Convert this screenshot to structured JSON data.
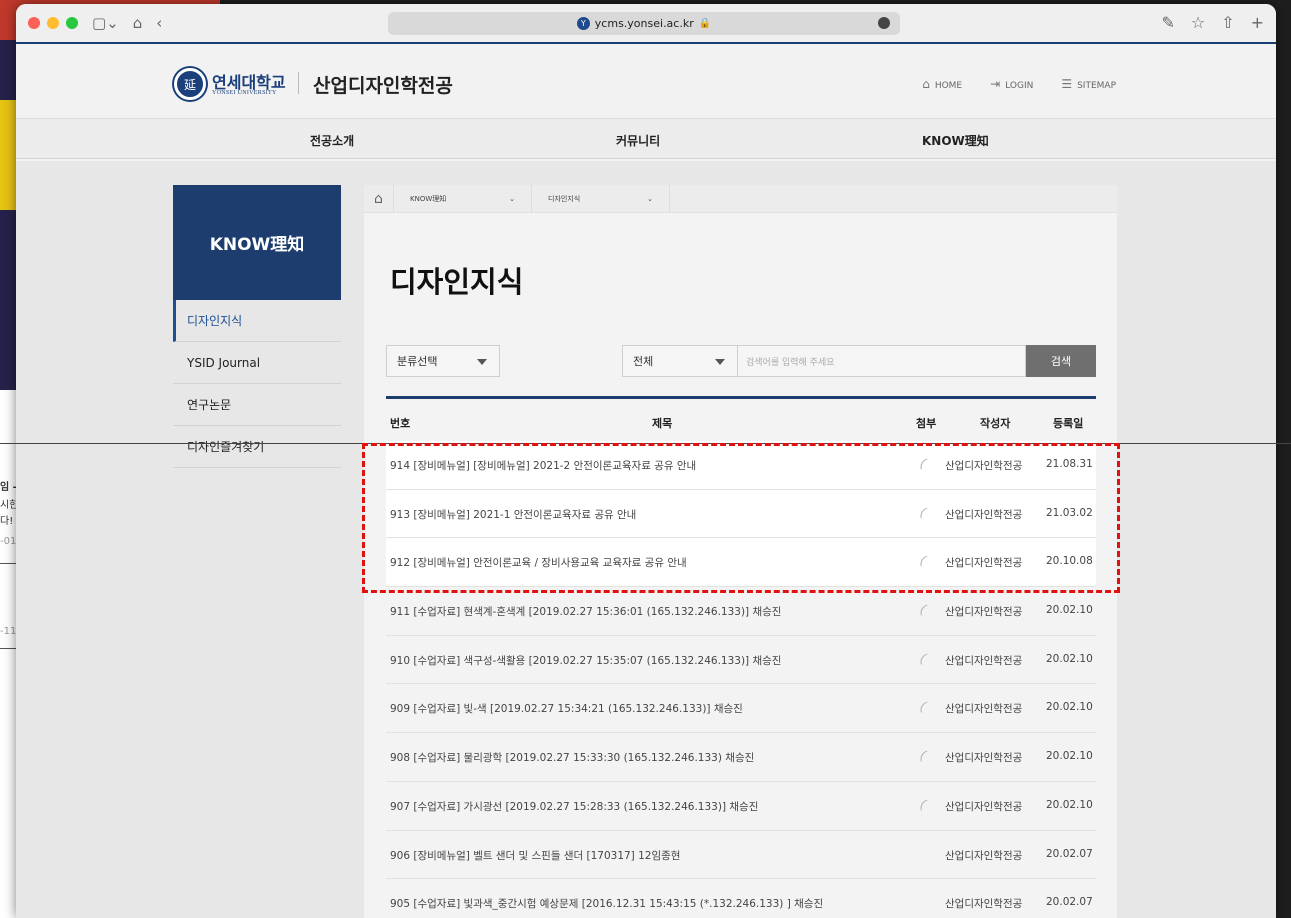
{
  "browser": {
    "url": "ycms.yonsei.ac.kr"
  },
  "background_window": {
    "fragments": [
      "임 -",
      "시한",
      "다!",
      "-01",
      "-11"
    ]
  },
  "header": {
    "logo_ko": "연세대학교",
    "logo_en": "YONSEI UNIVERSITY",
    "dept": "산업디자인학전공",
    "util": {
      "home": "HOME",
      "login": "LOGIN",
      "sitemap": "SITEMAP"
    }
  },
  "gnb": [
    "전공소개",
    "커뮤니티",
    "KNOW理知"
  ],
  "lnb": {
    "title": "KNOW理知",
    "items": [
      "디자인지식",
      "YSID Journal",
      "연구논문",
      "디자인즐겨찾기"
    ]
  },
  "breadcrumb": [
    "KNOW理知",
    "디자인지식"
  ],
  "page_title": "디자인지식",
  "search": {
    "category": "분류선택",
    "scope": "전체",
    "placeholder": "검색어를 입력해 주세요",
    "button": "검색"
  },
  "table": {
    "headers": {
      "no": "번호",
      "title": "제목",
      "attach": "첨부",
      "author": "작성자",
      "date": "등록일"
    },
    "rows": [
      {
        "title": "914 [장비메뉴얼] [장비메뉴얼] 2021-2 안전이론교육자료 공유 안내",
        "author": "산업디자인학전공",
        "date": "21.08.31",
        "attach": true
      },
      {
        "title": "913 [장비메뉴얼] 2021-1 안전이론교육자료 공유 안내",
        "author": "산업디자인학전공",
        "date": "21.03.02",
        "attach": true
      },
      {
        "title": "912 [장비메뉴얼] 안전이론교육 / 장비사용교육 교육자료 공유 안내",
        "author": "산업디자인학전공",
        "date": "20.10.08",
        "attach": true
      },
      {
        "title": "911 [수업자료] 현색계-혼색계 [2019.02.27 15:36:01 (165.132.246.133)] 채승진",
        "author": "산업디자인학전공",
        "date": "20.02.10",
        "attach": true
      },
      {
        "title": "910 [수업자료] 색구성-색활용 [2019.02.27 15:35:07 (165.132.246.133)] 채승진",
        "author": "산업디자인학전공",
        "date": "20.02.10",
        "attach": true
      },
      {
        "title": "909 [수업자료] 빛-색 [2019.02.27 15:34:21 (165.132.246.133)] 채승진",
        "author": "산업디자인학전공",
        "date": "20.02.10",
        "attach": true
      },
      {
        "title": "908 [수업자료] 물리광학 [2019.02.27 15:33:30 (165.132.246.133) 채승진",
        "author": "산업디자인학전공",
        "date": "20.02.10",
        "attach": true
      },
      {
        "title": "907 [수업자료] 가시광선 [2019.02.27 15:28:33 (165.132.246.133)] 채승진",
        "author": "산업디자인학전공",
        "date": "20.02.10",
        "attach": true
      },
      {
        "title": "906 [장비메뉴얼] 벨트 샌더 및 스핀들 샌더 [170317] 12임종현",
        "author": "산업디자인학전공",
        "date": "20.02.07",
        "attach": false
      },
      {
        "title": "905 [수업자료] 빛과색_중간시험 예상문제 [2016.12.31 15:43:15 (*.132.246.133) ] 채승진",
        "author": "산업디자인학전공",
        "date": "20.02.07",
        "attach": false
      }
    ]
  },
  "colors": {
    "brand": "#1c3d6e",
    "highlight": "#e0120f"
  }
}
